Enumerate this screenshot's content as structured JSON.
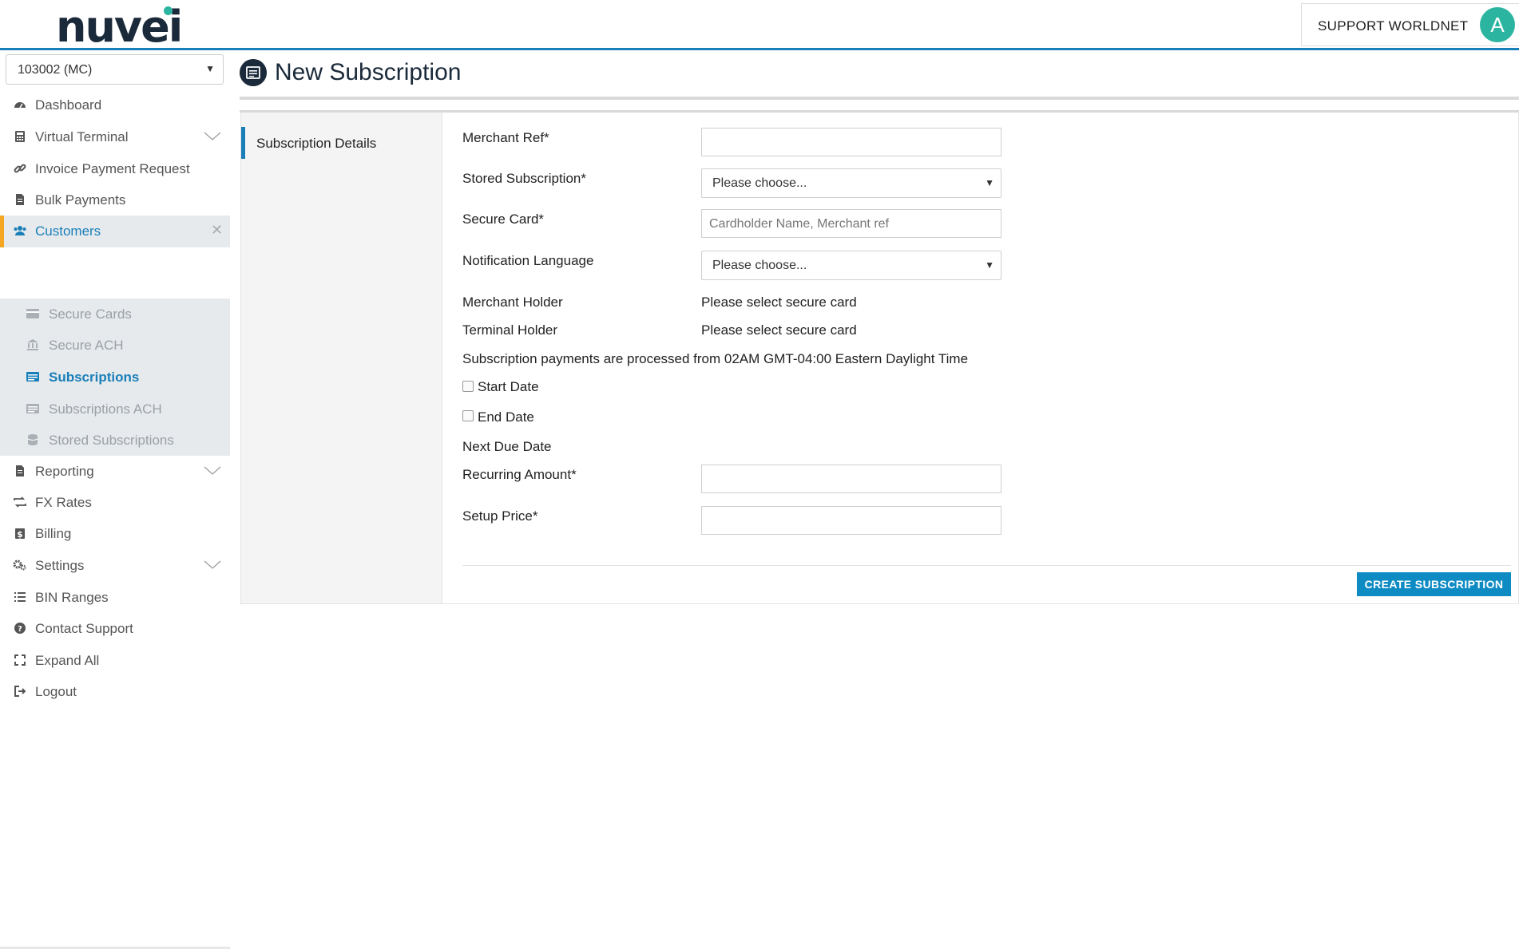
{
  "header": {
    "logo": "nuvei",
    "user_name": "SUPPORT WORLDNET",
    "avatar_initial": "A",
    "brand_color": "#1a7fb8",
    "accent_color": "#2bb5a0"
  },
  "sidebar": {
    "merchant_select": "103002 (MC)",
    "items": [
      {
        "label": "Dashboard",
        "icon": "dashboard-icon"
      },
      {
        "label": "Virtual Terminal",
        "icon": "calculator-icon",
        "expandable": true
      },
      {
        "label": "Invoice Payment Request",
        "icon": "link-icon"
      },
      {
        "label": "Bulk Payments",
        "icon": "file-icon"
      },
      {
        "label": "Customers",
        "icon": "users-icon",
        "active": true
      },
      {
        "label": "Reporting",
        "icon": "file-icon",
        "expandable": true
      },
      {
        "label": "FX Rates",
        "icon": "exchange-icon"
      },
      {
        "label": "Billing",
        "icon": "dollar-icon"
      },
      {
        "label": "Settings",
        "icon": "gears-icon",
        "expandable": true
      },
      {
        "label": "BIN Ranges",
        "icon": "list-icon"
      },
      {
        "label": "Contact Support",
        "icon": "question-icon"
      },
      {
        "label": "Expand All",
        "icon": "expand-icon"
      },
      {
        "label": "Logout",
        "icon": "logout-icon"
      }
    ],
    "customers_sub": [
      {
        "label": "Secure Cards",
        "icon": "card-icon"
      },
      {
        "label": "Secure ACH",
        "icon": "bank-icon"
      },
      {
        "label": "Subscriptions",
        "icon": "subscription-icon",
        "current": true
      },
      {
        "label": "Subscriptions ACH",
        "icon": "subscription-icon"
      },
      {
        "label": "Stored Subscriptions",
        "icon": "database-icon"
      }
    ]
  },
  "main": {
    "title": "New Subscription",
    "tab": "Subscription Details",
    "form": {
      "merchant_ref_label": "Merchant Ref*",
      "stored_subscription_label": "Stored Subscription*",
      "stored_subscription_value": "Please choose...",
      "secure_card_label": "Secure Card*",
      "secure_card_placeholder": "Cardholder Name, Merchant ref",
      "notification_language_label": "Notification Language",
      "notification_language_value": "Please choose...",
      "merchant_holder_label": "Merchant Holder",
      "merchant_holder_value": "Please select secure card",
      "terminal_holder_label": "Terminal Holder",
      "terminal_holder_value": "Please select secure card",
      "processing_note": "Subscription payments are processed from 02AM GMT-04:00 Eastern Daylight Time",
      "start_date_label": "Start Date",
      "end_date_label": "End Date",
      "next_due_date_label": "Next Due Date",
      "recurring_amount_label": "Recurring Amount*",
      "setup_price_label": "Setup Price*"
    },
    "create_button": "CREATE SUBSCRIPTION"
  }
}
